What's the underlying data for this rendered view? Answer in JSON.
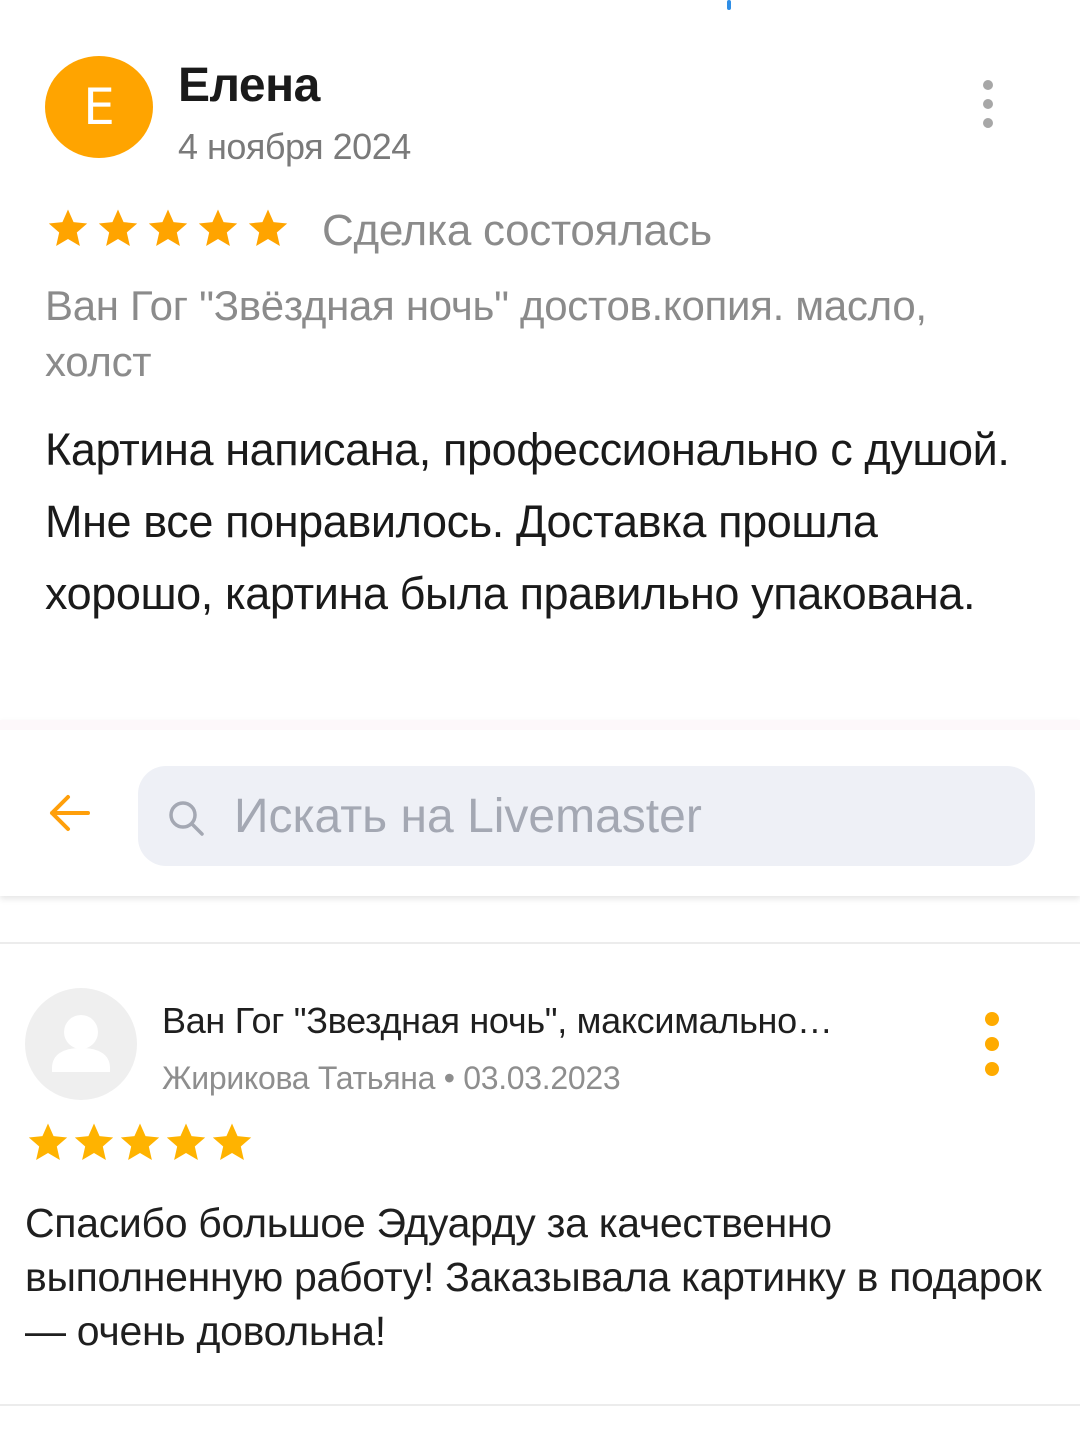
{
  "colors": {
    "accent": "#ffa400",
    "star": "#ffa400",
    "star_dark": "#ffb300",
    "secondary_text": "#8b8b8b",
    "search_bg": "#eef0f6",
    "more_dots_2": "#ffab00"
  },
  "review_1": {
    "avatar_letter": "Е",
    "author": "Елена",
    "date": "4 ноября 2024",
    "rating": 5,
    "status": "Сделка состоялась",
    "product": "Ван Гог \"Звёздная ночь\" достов.копия. масло, холст",
    "text": "Картина написана, профессионально с душой. Мне все понравилось. Доставка прошла хорошо, картина была правильно упакована.",
    "more_icon": "more-vertical-icon"
  },
  "search": {
    "back_icon": "arrow-left-icon",
    "search_icon": "search-icon",
    "placeholder": "Искать на Livemaster"
  },
  "review_2": {
    "avatar_icon": "user-placeholder-icon",
    "title": "Ван Гог \"Звездная ночь\", максимально…",
    "author": "Жирикова Татьяна",
    "separator": "•",
    "date": "03.03.2023",
    "meta": "Жирикова Татьяна • 03.03.2023",
    "rating": 5,
    "text": "Спасибо большое Эдуарду за качественно выполненную работу! Заказывала картинку в подарок — очень довольна!",
    "more_icon": "more-vertical-icon"
  }
}
